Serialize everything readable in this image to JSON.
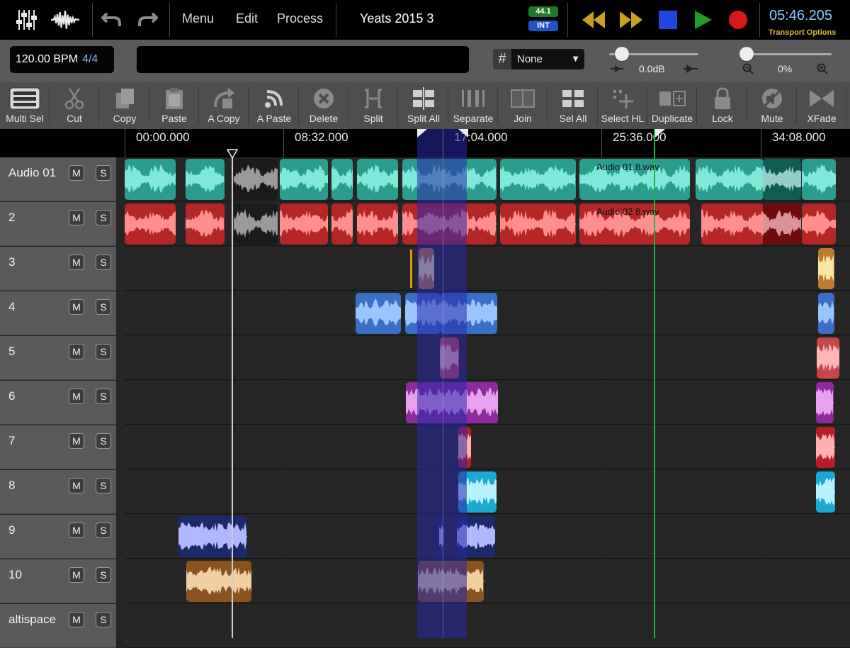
{
  "header": {
    "menu": "Menu",
    "edit": "Edit",
    "process": "Process",
    "project_title": "Yeats 2015 3",
    "sample_rate": "44.1",
    "clock_source": "INT",
    "time": "05:46.205",
    "transport_options": "Transport Options",
    "colors": {
      "rate_badge": "#1e7a28",
      "clock_badge": "#1f55c8",
      "rewind": "#c8a21c",
      "stop": "#1f47e0",
      "play": "#1f9c2e",
      "record": "#d41a1a"
    }
  },
  "controls": {
    "bpm": "120.00 BPM",
    "time_signature": "4/4",
    "snap_value": "None",
    "volume": "0.0dB",
    "zoom": "0%",
    "volume_level": 0.15,
    "zoom_level": 0.0
  },
  "toolbar": [
    {
      "label": "Multi Sel",
      "icon": "multi-select-icon"
    },
    {
      "label": "Cut",
      "icon": "scissors-icon"
    },
    {
      "label": "Copy",
      "icon": "copy-icon"
    },
    {
      "label": "Paste",
      "icon": "clipboard-icon"
    },
    {
      "label": "A Copy",
      "icon": "auto-copy-icon"
    },
    {
      "label": "A Paste",
      "icon": "auto-paste-icon"
    },
    {
      "label": "Delete",
      "icon": "delete-icon"
    },
    {
      "label": "Split",
      "icon": "split-icon"
    },
    {
      "label": "Split All",
      "icon": "split-all-icon"
    },
    {
      "label": "Separate",
      "icon": "separate-icon"
    },
    {
      "label": "Join",
      "icon": "join-icon"
    },
    {
      "label": "Sel All",
      "icon": "select-all-icon"
    },
    {
      "label": "Select HL",
      "icon": "select-highlight-icon"
    },
    {
      "label": "Duplicate",
      "icon": "duplicate-icon"
    },
    {
      "label": "Lock",
      "icon": "lock-icon"
    },
    {
      "label": "Mute",
      "icon": "mute-icon"
    },
    {
      "label": "XFade",
      "icon": "crossfade-icon"
    }
  ],
  "ruler": [
    "00:00.000",
    "08:32.000",
    "17:04.000",
    "25:36.000",
    "34:08.000"
  ],
  "tracks": [
    {
      "name": "Audio 01",
      "mute": "M",
      "solo": "S",
      "color": "#2a9d8f",
      "clip_label": "Audio 01 8.wav"
    },
    {
      "name": "2",
      "mute": "M",
      "solo": "S",
      "color": "#b52626",
      "clip_label": "Audio 02 8.wav"
    },
    {
      "name": "3",
      "mute": "M",
      "solo": "S",
      "color": "#c07a30"
    },
    {
      "name": "4",
      "mute": "M",
      "solo": "S",
      "color": "#3b6fc7"
    },
    {
      "name": "5",
      "mute": "M",
      "solo": "S",
      "color": "#c74747"
    },
    {
      "name": "6",
      "mute": "M",
      "solo": "S",
      "color": "#8e2a9e"
    },
    {
      "name": "7",
      "mute": "M",
      "solo": "S",
      "color": "#b81e2a"
    },
    {
      "name": "8",
      "mute": "M",
      "solo": "S",
      "color": "#1ba9cf"
    },
    {
      "name": "9",
      "mute": "M",
      "solo": "S",
      "color": "#1c2a6a"
    },
    {
      "name": "10",
      "mute": "M",
      "solo": "S",
      "color": "#8a5320"
    },
    {
      "name": "altispace",
      "mute": "M",
      "solo": "S",
      "color": "#555555"
    }
  ]
}
